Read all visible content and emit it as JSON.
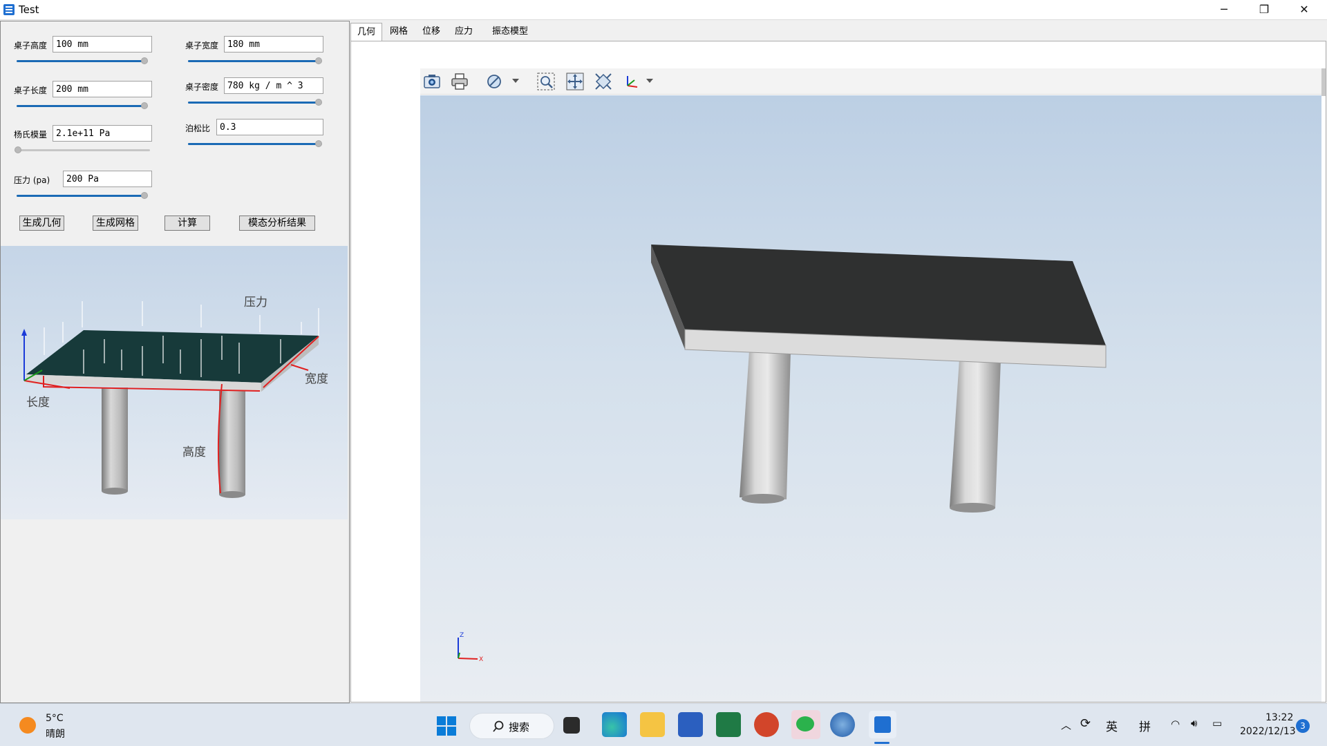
{
  "window": {
    "title": "Test",
    "controls": {
      "minimize": "─",
      "restore": "❐",
      "close": "✕"
    }
  },
  "params": {
    "table_height": {
      "label": "桌子高度",
      "value": "100 mm",
      "slider_fraction": 1.0
    },
    "table_width": {
      "label": "桌子宽度",
      "value": "180 mm",
      "slider_fraction": 1.0
    },
    "table_length": {
      "label": "桌子长度",
      "value": "200 mm",
      "slider_fraction": 1.0
    },
    "table_density": {
      "label": "桌子密度",
      "value": "780 kg / m ^ 3",
      "slider_fraction": 1.0
    },
    "youngs_modulus": {
      "label": "杨氏模量",
      "value": "2.1e+11 Pa",
      "slider_fraction": 0.0
    },
    "poisson_ratio": {
      "label": "泊松比",
      "value": "0.3",
      "slider_fraction": 1.0
    },
    "pressure": {
      "label": "压力 (pa)",
      "value": "200 Pa",
      "slider_fraction": 1.0
    }
  },
  "buttons": {
    "generate_geometry": "生成几何",
    "generate_mesh": "生成网格",
    "compute": "计算",
    "modal_results": "模态分析结果"
  },
  "diagram": {
    "pressure_label": "压力",
    "width_label": "宽度",
    "length_label": "长度",
    "height_label": "高度"
  },
  "tabs": [
    "几何",
    "网格",
    "位移",
    "应力",
    "振态模型"
  ],
  "active_tab": "几何",
  "toolbar": {
    "icons": [
      "camera-icon",
      "print-icon",
      "clip-plane-icon",
      "zoom-box-icon",
      "fit-all-icon",
      "fit-view-icon",
      "axes-orientation-icon"
    ]
  },
  "axes_triad": {
    "z": "Z",
    "x": "X"
  },
  "taskbar": {
    "weather_temp": "5°C",
    "weather_desc": "晴朗",
    "search_label": "搜索",
    "ime_lang": "英",
    "ime_mode": "拼",
    "time": "13:22",
    "date": "2022/12/13",
    "notification_count": "3"
  },
  "colors": {
    "accent": "#1a6ab5",
    "table_top": "#2f3030",
    "table_edge": "#dcdcdc",
    "diagram_top": "#173a3a",
    "annotation_red": "#e02020"
  }
}
